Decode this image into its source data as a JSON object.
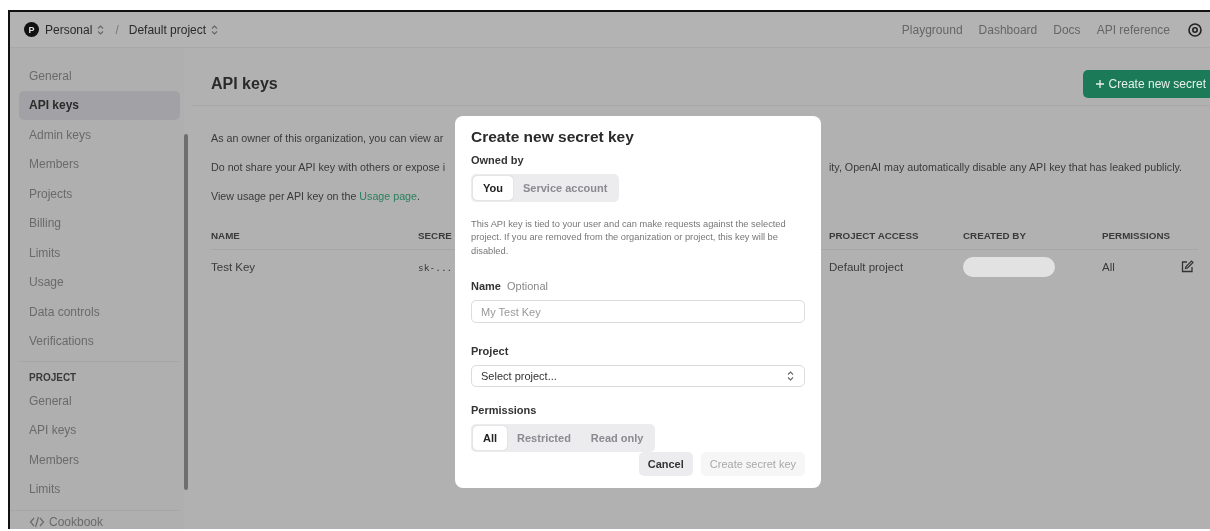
{
  "top_bar": {
    "org": {
      "avatar": "P",
      "label": "Personal"
    },
    "separator": "/",
    "project": "Default project",
    "nav": [
      "Playground",
      "Dashboard",
      "Docs",
      "API reference"
    ]
  },
  "sidebar": {
    "sections": [
      {
        "items": [
          {
            "label": "General",
            "selected": false
          },
          {
            "label": "API keys",
            "selected": true
          },
          {
            "label": "Admin keys",
            "selected": false
          },
          {
            "label": "Members",
            "selected": false
          },
          {
            "label": "Projects",
            "selected": false
          },
          {
            "label": "Billing",
            "selected": false
          },
          {
            "label": "Limits",
            "selected": false
          },
          {
            "label": "Usage",
            "selected": false
          },
          {
            "label": "Data controls",
            "selected": false
          },
          {
            "label": "Verifications",
            "selected": false
          }
        ]
      },
      {
        "heading": "PROJECT",
        "items": [
          {
            "label": "General",
            "selected": false
          },
          {
            "label": "API keys",
            "selected": false
          },
          {
            "label": "Members",
            "selected": false
          },
          {
            "label": "Limits",
            "selected": false
          }
        ]
      }
    ],
    "footer_link": "Cookbook"
  },
  "main": {
    "title": "API keys",
    "create_button": "Create new secret",
    "paragraphs": [
      {
        "left": "As an owner of this organization, you can view ar"
      },
      {
        "left": "Do not share your API key with others or expose i",
        "right": "ity, OpenAI may automatically disable any API key that has leaked publicly."
      },
      {
        "left": "View usage per API key on the ",
        "link": "Usage page",
        "after": "."
      }
    ],
    "table": {
      "columns": [
        "NAME",
        "SECRE",
        "PROJECT ACCESS",
        "CREATED BY",
        "PERMISSIONS"
      ],
      "rows": [
        {
          "name": "Test Key",
          "secret": "sk-...",
          "project_access": "Default project",
          "created_by": {
            "redacted": true
          },
          "permissions": "All"
        }
      ]
    }
  },
  "dialog": {
    "title": "Create new secret key",
    "owned_by": {
      "label": "Owned by",
      "options": [
        {
          "label": "You",
          "selected": true
        },
        {
          "label": "Service account",
          "selected": false
        }
      ]
    },
    "description": "This API key is tied to your user and can make requests against the selected project. If you are removed from the organization or project, this key will be disabled.",
    "name_field": {
      "label": "Name",
      "hint": "Optional",
      "placeholder": "My Test Key"
    },
    "project_select": {
      "label": "Project",
      "value": "Select project..."
    },
    "permissions": {
      "label": "Permissions",
      "options": [
        {
          "label": "All",
          "selected": true
        },
        {
          "label": "Restricted",
          "selected": false
        },
        {
          "label": "Read only",
          "selected": false
        }
      ]
    },
    "buttons": [
      {
        "label": "Cancel",
        "kind": "secondary",
        "disabled": false
      },
      {
        "label": "Create secret key",
        "kind": "primary",
        "disabled": true
      }
    ]
  }
}
